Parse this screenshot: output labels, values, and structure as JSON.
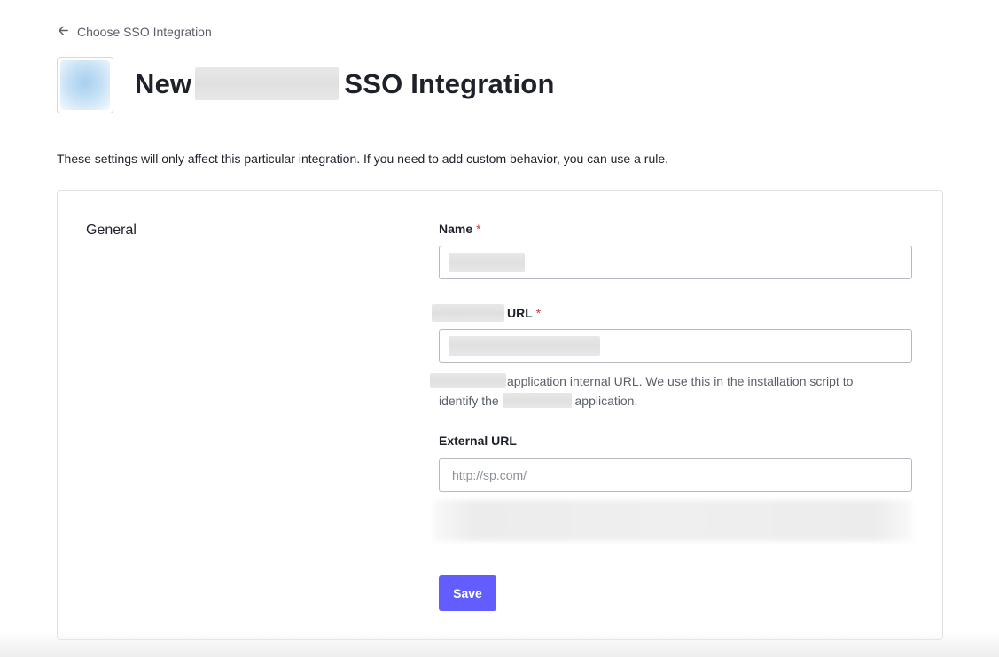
{
  "breadcrumb": {
    "back_label": "Choose SSO Integration"
  },
  "header": {
    "title_prefix": "New",
    "title_suffix": "SSO Integration"
  },
  "intro_text": "These settings will only affect this particular integration. If you need to add custom behavior, you can use a rule.",
  "general": {
    "section_title": "General",
    "name_field": {
      "label": "Name",
      "required_mark": "*",
      "value": ""
    },
    "url_field": {
      "label": "URL",
      "required_mark": "*",
      "value": "",
      "help_part1": "application internal URL. We use this in the installation script to",
      "help_part2": "identify the",
      "help_part3": "application."
    },
    "external_url_field": {
      "label": "External URL",
      "placeholder": "http://sp.com/",
      "value": ""
    },
    "save_label": "Save"
  },
  "colors": {
    "accent": "#635dff",
    "required": "#d03c38",
    "text": "#1e212a",
    "muted": "#5a5f6a"
  }
}
